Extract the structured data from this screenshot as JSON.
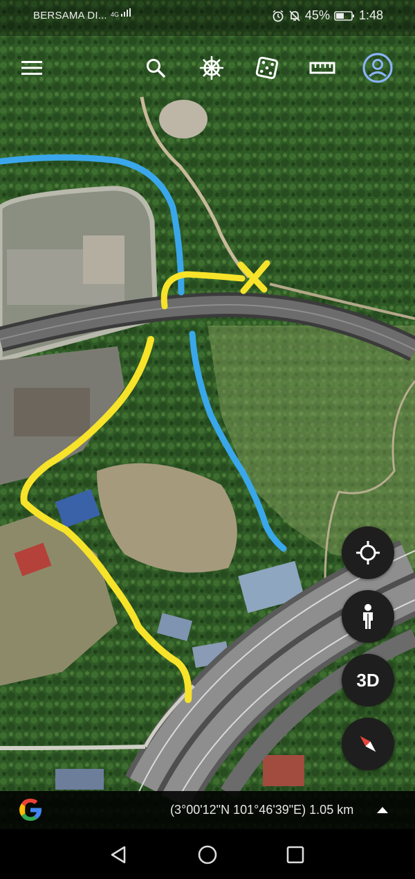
{
  "status_bar": {
    "carrier": "BERSAMA DI...",
    "network": "4G",
    "battery": "45%",
    "time": "1:48"
  },
  "toolbar": {
    "icons": [
      "menu-icon",
      "search-icon",
      "voyager-wheel-icon",
      "dice-icon",
      "ruler-icon",
      "account-icon"
    ]
  },
  "map_controls": {
    "locate_icon": "crosshair-icon",
    "pegman_icon": "pegman-icon",
    "label_3d": "3D",
    "compass_icon": "compass-icon"
  },
  "bottom_bar": {
    "coordinates": "(3°00'12\"N 101°46'39\"E) 1.05 km",
    "logo": "google-g-logo",
    "expand_icon": "caret-up-icon"
  },
  "nav_bar": {
    "buttons": [
      "back-icon",
      "home-icon",
      "recents-icon"
    ]
  },
  "colors": {
    "blue_path": "#3aa7ea",
    "yellow_path": "#f7e32a",
    "forest": "#2f5a26",
    "account_blue": "#8ab4f8"
  }
}
